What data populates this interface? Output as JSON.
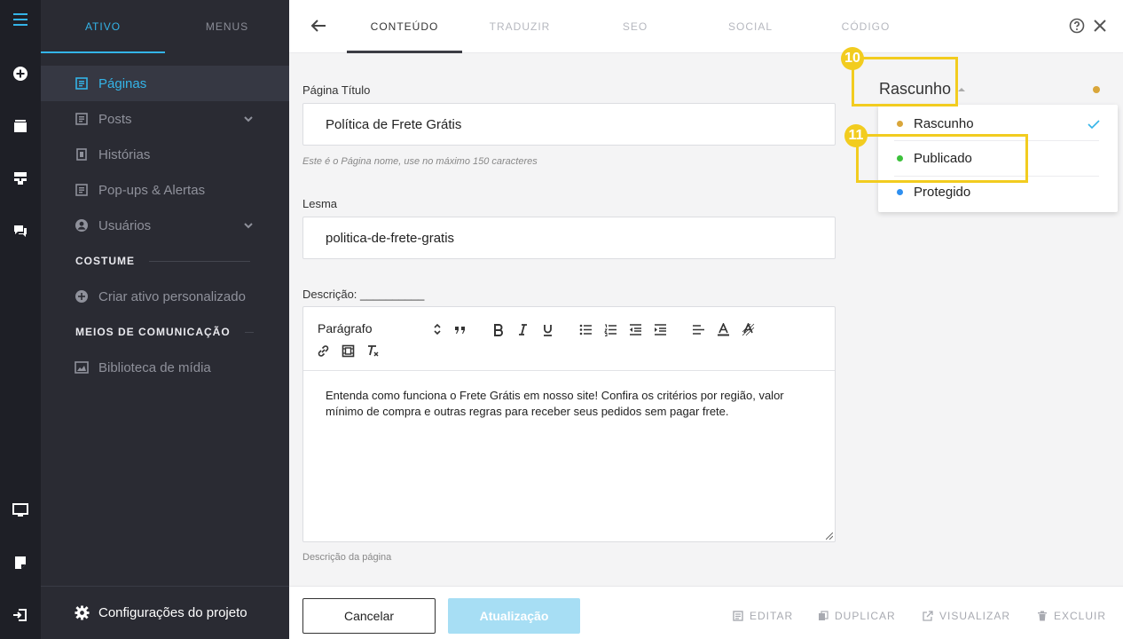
{
  "sidebar": {
    "tabs": [
      "ATIVO",
      "MENUS"
    ],
    "items": [
      {
        "label": "Páginas",
        "icon": "page-icon"
      },
      {
        "label": "Posts",
        "icon": "post-icon"
      },
      {
        "label": "Histórias",
        "icon": "story-icon"
      },
      {
        "label": "Pop-ups & Alertas",
        "icon": "popup-icon"
      },
      {
        "label": "Usuários",
        "icon": "user-icon"
      }
    ],
    "section_custom": "COSTUME",
    "custom_item": "Criar ativo personalizado",
    "section_media": "MEIOS DE COMUNICAÇÃO",
    "media_item": "Biblioteca de mídia",
    "settings": "Configurações do projeto"
  },
  "topbar": {
    "tabs": [
      "CONTEÚDO",
      "TRADUZIR",
      "SEO",
      "SOCIAL",
      "CÓDIGO"
    ]
  },
  "form": {
    "title_label": "Página Título",
    "title_value": "Política de Frete Grátis",
    "title_hint": "Este é o Página nome, use no máximo 150 caracteres",
    "slug_label": "Lesma",
    "slug_value": "politica-de-frete-gratis",
    "desc_label": "Descrição: __________",
    "paragraph_select": "Parágrafo",
    "desc_text": "Entenda como funciona o Frete Grátis em nosso site! Confira os critérios por região, valor mínimo de compra e outras regras para receber seus pedidos sem pagar frete.",
    "desc_hint": "Descrição da página"
  },
  "status": {
    "current": "Rascunho",
    "options": [
      {
        "label": "Rascunho",
        "color": "#d9a63a"
      },
      {
        "label": "Publicado",
        "color": "#3cc13b"
      },
      {
        "label": "Protegido",
        "color": "#2e8ff0"
      }
    ]
  },
  "callouts": [
    "10",
    "11"
  ],
  "footer": {
    "cancel": "Cancelar",
    "update": "Atualização",
    "actions": [
      "EDITAR",
      "DUPLICAR",
      "VISUALIZAR",
      "EXCLUIR"
    ]
  },
  "colors": {
    "accent": "#34b4e8",
    "callout": "#f2cc1f"
  }
}
